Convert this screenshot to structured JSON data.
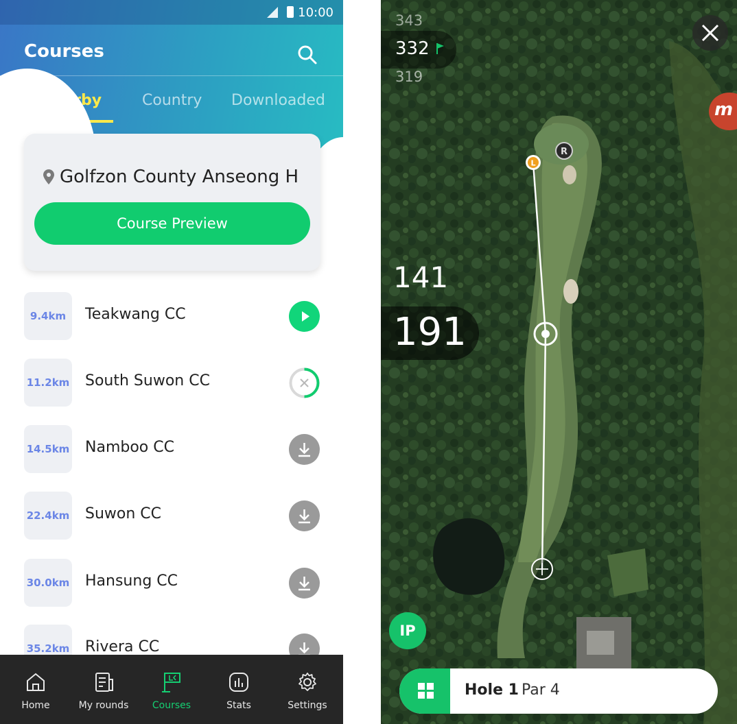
{
  "left": {
    "status": {
      "time": "10:00"
    },
    "header": {
      "title": "Courses"
    },
    "tabs": [
      {
        "label": "Nearby",
        "active": true
      },
      {
        "label": "Country",
        "active": false
      },
      {
        "label": "Downloaded",
        "active": false
      }
    ],
    "featured": {
      "course_name": "Golfzon County Anseong H",
      "preview_label": "Course Preview"
    },
    "courses": [
      {
        "distance": "9.4km",
        "name": "Teakwang CC",
        "action": "play"
      },
      {
        "distance": "11.2km",
        "name": "South Suwon CC",
        "action": "downloading"
      },
      {
        "distance": "14.5km",
        "name": "Namboo CC",
        "action": "download"
      },
      {
        "distance": "22.4km",
        "name": "Suwon CC",
        "action": "download"
      },
      {
        "distance": "30.0km",
        "name": "Hansung CC",
        "action": "download"
      },
      {
        "distance": "35.2km",
        "name": "Rivera CC",
        "action": "download"
      }
    ],
    "nav": [
      {
        "label": "Home",
        "icon": "home-icon",
        "active": false
      },
      {
        "label": "My rounds",
        "icon": "scorecard-icon",
        "active": false
      },
      {
        "label": "Courses",
        "icon": "course-flag-icon",
        "active": true
      },
      {
        "label": "Stats",
        "icon": "stats-icon",
        "active": false
      },
      {
        "label": "Settings",
        "icon": "gear-icon",
        "active": false
      }
    ],
    "colors": {
      "accent": "#11cc6f",
      "tab_active": "#ffe94a",
      "distance_text": "#6b86e6"
    }
  },
  "right": {
    "green_distances": {
      "back": "343",
      "center": "332",
      "front": "319"
    },
    "markers": {
      "left_pin": "L",
      "right_pin": "R"
    },
    "yardage": {
      "to_target": "141",
      "from_target": "191"
    },
    "ip_label": "IP",
    "hole": {
      "label": "Hole 1",
      "par": "Par 4"
    },
    "badge_letter": "m",
    "colors": {
      "accent": "#16c26a"
    }
  }
}
